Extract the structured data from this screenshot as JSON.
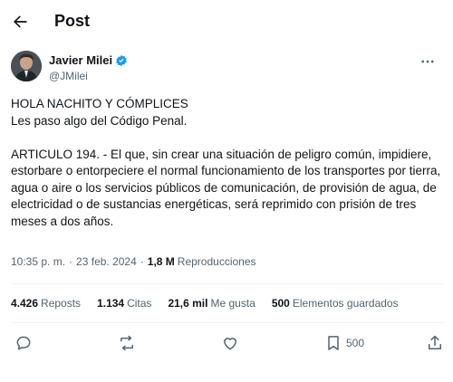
{
  "header": {
    "title": "Post",
    "back_icon": "arrow-left-icon"
  },
  "author": {
    "display_name": "Javier Milei",
    "handle": "@JMilei",
    "verified_color": "#1d9bf0"
  },
  "tweet": {
    "lines": [
      "HOLA NACHITO Y CÓMPLICES",
      "Les paso algo del Código Penal."
    ],
    "article": "ARTICULO 194. - El que, sin crear una situación de peligro común, impidiere, estorbare o entorpeciere el normal funcionamiento de los transportes por tierra, agua o aire o los servicios públicos de comunicación, de provisión de agua, de electricidad o de sustancias energéticas, será reprimido con prisión de tres meses a dos años."
  },
  "meta": {
    "time": "10:35 p. m.",
    "separator": "·",
    "date": "23 feb. 2024",
    "views_num": "1,8 M",
    "views_label": "Reproducciones"
  },
  "stats": {
    "reposts_num": "4.426",
    "reposts_label": "Reposts",
    "quotes_num": "1.134",
    "quotes_label": "Citas",
    "likes_num": "21,6 mil",
    "likes_label": "Me gusta",
    "bookmarks_num": "500",
    "bookmarks_label": "Elementos guardados"
  },
  "actions": {
    "bookmark_count": "500"
  },
  "colors": {
    "text": "#0f1419",
    "secondary": "#536471",
    "accent": "#1d9bf0",
    "divider": "#eff3f4"
  }
}
